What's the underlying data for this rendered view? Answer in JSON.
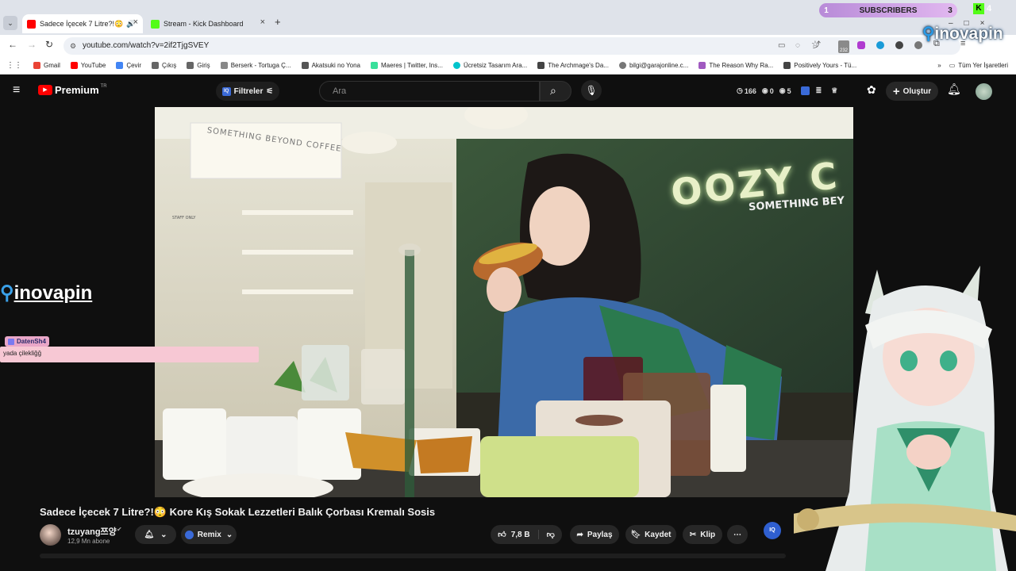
{
  "browser": {
    "tabs": [
      {
        "title": "Sadece İçecek 7 Litre?!😳 K",
        "active": true
      },
      {
        "title": "Stream - Kick Dashboard",
        "active": false
      }
    ],
    "url": "youtube.com/watch?v=2if2TjgSVEY",
    "extension_badge": "232",
    "bookmarks": [
      "Gmail",
      "YouTube",
      "Çevir",
      "Çıkış",
      "Giriş",
      "Berserk - Tortuga Ç...",
      "Akatsuki no Yona",
      "Maeres | Twitter, Ins...",
      "Ücretsiz Tasarım Ara...",
      "The Archmage's Da...",
      "bilgi@garajonline.c...",
      "The Reason Why Ra...",
      "Positively Yours - Tü..."
    ],
    "all_bookmarks": "Tüm Yer İşaretleri"
  },
  "overlay": {
    "subscribers_label": "SUBSCRIBERS",
    "subscribers_left": "1",
    "subscribers_right": "3",
    "kick_count": "4",
    "brand": "inovapin",
    "chat_user": "DatenSh4",
    "chat_message": "yada çilekliğğ"
  },
  "youtube": {
    "logo_text": "Premium",
    "logo_sup": "TR",
    "filters_label": "Filtreler",
    "search_placeholder": "Ara",
    "stats": [
      "166",
      "0",
      "5"
    ],
    "create_label": "Oluştur",
    "video": {
      "sign_top": "SOMETHING BEYOND COFFEE",
      "sign_brand": "OOZY C",
      "sign_sub": "SOMETHING BEY",
      "staff_sign": "STAFF ONLY"
    },
    "video_title": "Sadece İçecek 7 Litre?!😳 Kore Kış Sokak Lezzetleri Balık Çorbası Kremalı Sosis",
    "channel_name": "tzuyang쯔양",
    "subscribers": "12,9 Mn abone",
    "remix_label": "Remix",
    "likes": "7,8 B",
    "share_label": "Paylaş",
    "save_label": "Kaydet",
    "clip_label": "Klip"
  }
}
